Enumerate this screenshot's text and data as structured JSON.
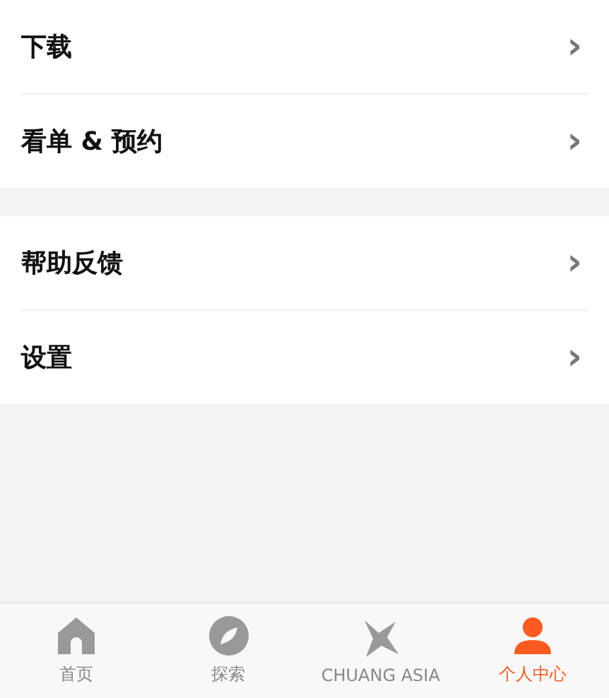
{
  "menu_groups": [
    {
      "items": [
        {
          "label": "下载",
          "chevron": "›"
        },
        {
          "label": "看单 & 预约",
          "chevron": "›"
        }
      ]
    },
    {
      "items": [
        {
          "label": "帮助反馈",
          "chevron": "›"
        },
        {
          "label": "设置",
          "chevron": "›"
        }
      ]
    }
  ],
  "tab_bar": [
    {
      "label": "首页",
      "kind": "home",
      "selected": false
    },
    {
      "label": "探索",
      "kind": "compass",
      "selected": false
    },
    {
      "label": "CHUANG ASIA",
      "kind": "pinwheel",
      "selected": false
    },
    {
      "label": "个人中心",
      "kind": "person",
      "selected": true
    }
  ]
}
